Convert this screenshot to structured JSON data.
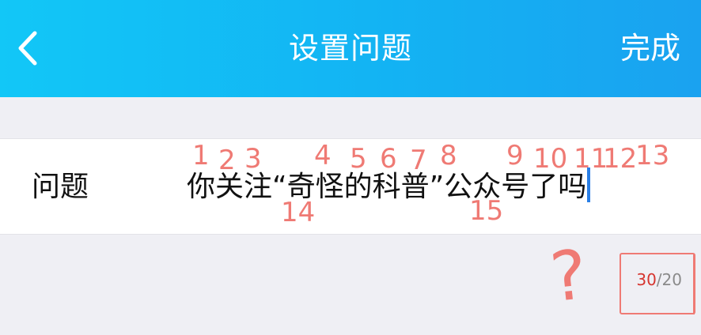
{
  "nav": {
    "title": "设置问题",
    "done_label": "完成",
    "back_icon": "chevron-left-icon"
  },
  "form": {
    "label": "问题",
    "value": "你关注“奇怪的科普”公众号了吗"
  },
  "counter": {
    "current": "30",
    "separator": "/",
    "max": "20"
  },
  "annotations": {
    "numbers": [
      "1",
      "2",
      "3",
      "4",
      "5",
      "6",
      "7",
      "8",
      "9",
      "10",
      "11",
      "12",
      "13",
      "14",
      "15"
    ],
    "question_mark": "?"
  },
  "colors": {
    "nav_gradient_start": "#12c7f7",
    "nav_gradient_end": "#1aa2f0",
    "annotation": "#ef7a74",
    "caret": "#2a7fe6",
    "counter_over": "#d6352f"
  }
}
